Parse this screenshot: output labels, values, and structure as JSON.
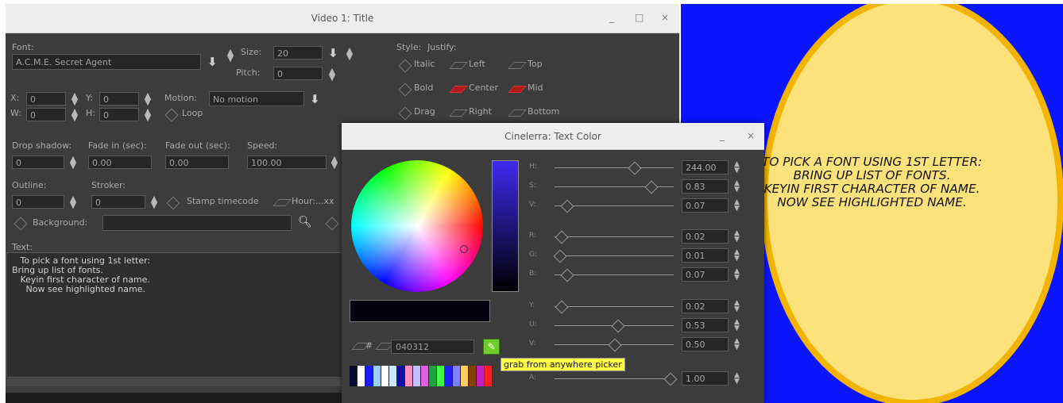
{
  "title_window": {
    "title": "Video 1: Title",
    "controls": {
      "minimize": "_",
      "maximize": "□",
      "close": "×"
    },
    "font_label": "Font:",
    "font_value": "A.C.M.E. Secret Agent",
    "size_label": "Size:",
    "size_value": "20",
    "pitch_label": "Pitch:",
    "pitch_value": "0",
    "style_label": "Style:",
    "justify_label": "Justify:",
    "italic_label": "Italic",
    "bold_label": "Bold",
    "drag_label": "Drag",
    "left_label": "Left",
    "center_label": "Center",
    "right_label": "Right",
    "top_label": "Top",
    "mid_label": "Mid",
    "bottom_label": "Bottom",
    "x_label": "X:",
    "x_value": "0",
    "y_label": "Y:",
    "y_value": "0",
    "w_label": "W:",
    "w_value": "0",
    "h_label": "H:",
    "h_value": "0",
    "motion_label": "Motion:",
    "motion_value": "No motion",
    "loop_label": "Loop",
    "drop_shadow_label": "Drop shadow:",
    "drop_shadow_value": "0",
    "fade_in_label": "Fade in (sec):",
    "fade_in_value": "0.00",
    "fade_out_label": "Fade out (sec):",
    "fade_out_value": "0.00",
    "speed_label": "Speed:",
    "speed_value": "100.00",
    "outline_label": "Outline:",
    "outline_value": "0",
    "stroker_label": "Stroker:",
    "stroker_value": "0",
    "stamp_label": "Stamp timecode",
    "timecode_format": "Hour:...xx",
    "background_label": "Background:",
    "text_label": "Text:",
    "text_lines": [
      "   To pick a font using 1st letter:",
      "Bring up list of fonts.",
      "   Keyin first character of name.",
      "     Now see highlighted name."
    ]
  },
  "preview": {
    "lines": [
      "TO PICK A FONT USING 1ST LETTER:",
      "BRING UP LIST OF FONTS.",
      "KEYIN FIRST CHARACTER OF NAME.",
      "NOW SEE HIGHLIGHTED NAME."
    ],
    "background_color": "#0b14ff",
    "circle_fill": "#fde27c",
    "circle_border": "#f3b400"
  },
  "color_dialog": {
    "title": "Cinelerra: Text Color",
    "controls": {
      "minimize": "_",
      "close": "×"
    },
    "hex_label": "#",
    "hex_value": "040312",
    "tooltip": "grab from anywhere picker",
    "sliders": [
      {
        "label": "H:",
        "value": "244.00",
        "level": 0.68
      },
      {
        "label": "S:",
        "value": "0.83",
        "level": 0.83
      },
      {
        "label": "V:",
        "value": "0.07",
        "level": 0.07
      },
      {
        "label": "R:",
        "value": "0.02",
        "level": 0.02
      },
      {
        "label": "G:",
        "value": "0.01",
        "level": 0.01
      },
      {
        "label": "B:",
        "value": "0.07",
        "level": 0.07
      },
      {
        "label": "Y:",
        "value": "0.02",
        "level": 0.02
      },
      {
        "label": "U:",
        "value": "0.53",
        "level": 0.53
      },
      {
        "label": "V:",
        "value": "0.50",
        "level": 0.5
      },
      {
        "label": "A:",
        "value": "1.00",
        "level": 1.0
      }
    ],
    "palette_colors": [
      "#0a0a30",
      "#ffffff",
      "#1a1aff",
      "#9ad0ff",
      "#ffffff",
      "#cce8ff",
      "#1010a0",
      "#ff90c0",
      "#c0c0ff",
      "#e060e0",
      "#20a040",
      "#40ff40",
      "#2020ff",
      "#8080ff",
      "#ffd060",
      "#804000",
      "#c020c0",
      "#ff2020"
    ]
  }
}
